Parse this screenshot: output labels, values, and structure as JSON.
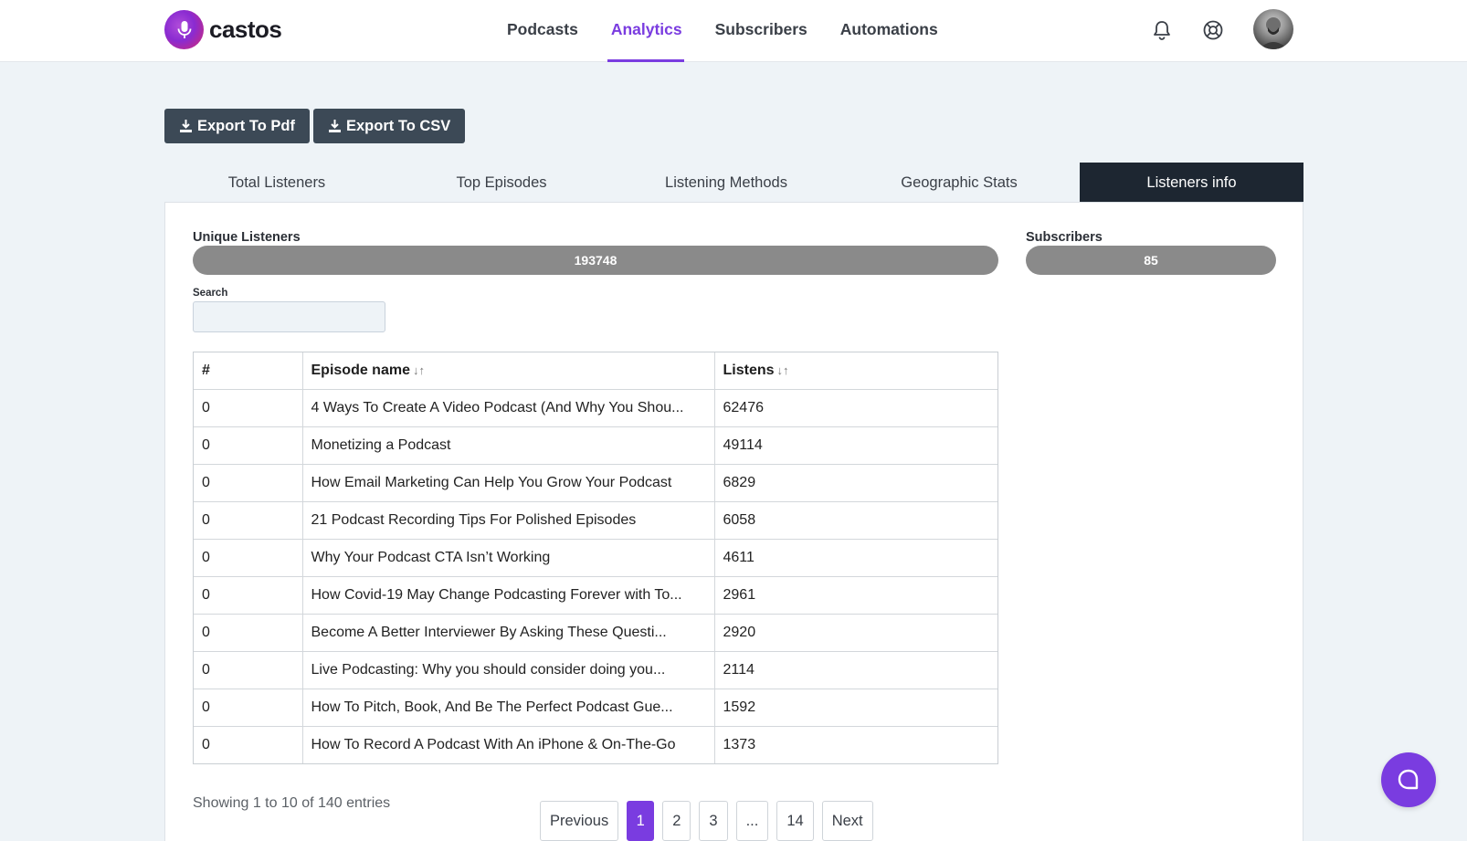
{
  "header": {
    "logo_text": "castos",
    "nav": [
      {
        "label": "Podcasts",
        "active": false
      },
      {
        "label": "Analytics",
        "active": true
      },
      {
        "label": "Subscribers",
        "active": false
      },
      {
        "label": "Automations",
        "active": false
      }
    ],
    "icons": [
      "bell-icon",
      "help-lifebuoy-icon",
      "avatar"
    ]
  },
  "toolbar": {
    "export_pdf_label": "Export To Pdf",
    "export_csv_label": "Export To CSV"
  },
  "tabs": [
    {
      "label": "Total Listeners",
      "active": false
    },
    {
      "label": "Top Episodes",
      "active": false
    },
    {
      "label": "Listening Methods",
      "active": false
    },
    {
      "label": "Geographic Stats",
      "active": false
    },
    {
      "label": "Listeners info",
      "active": true
    }
  ],
  "stats": {
    "unique_listeners_label": "Unique Listeners",
    "unique_listeners_value": "193748",
    "subscribers_label": "Subscribers",
    "subscribers_value": "85"
  },
  "search": {
    "label": "Search",
    "value": "",
    "placeholder": ""
  },
  "table": {
    "columns": [
      "#",
      "Episode name",
      "Listens"
    ],
    "sortable_columns": [
      "Episode name",
      "Listens"
    ],
    "rows": [
      {
        "num": "0",
        "episode": "4 Ways To Create A Video Podcast (And Why You Shou...",
        "listens": "62476"
      },
      {
        "num": "0",
        "episode": "Monetizing a Podcast",
        "listens": "49114"
      },
      {
        "num": "0",
        "episode": "How Email Marketing Can Help You Grow Your Podcast",
        "listens": "6829"
      },
      {
        "num": "0",
        "episode": "21 Podcast Recording Tips For Polished Episodes",
        "listens": "6058"
      },
      {
        "num": "0",
        "episode": "Why Your Podcast CTA Isn’t Working",
        "listens": "4611"
      },
      {
        "num": "0",
        "episode": "How Covid-19 May Change Podcasting Forever with To...",
        "listens": "2961"
      },
      {
        "num": "0",
        "episode": "Become A Better Interviewer By Asking These Questi...",
        "listens": "2920"
      },
      {
        "num": "0",
        "episode": "Live Podcasting: Why you should consider doing you...",
        "listens": "2114"
      },
      {
        "num": "0",
        "episode": "How To Pitch, Book, And Be The Perfect Podcast Gue...",
        "listens": "1592"
      },
      {
        "num": "0",
        "episode": "How To Record A Podcast With An iPhone & On-The-Go",
        "listens": "1373"
      }
    ]
  },
  "footer": {
    "showing_text": "Showing 1 to 10 of 140 entries",
    "pagination": {
      "previous_label": "Previous",
      "pages": [
        "1",
        "2",
        "3",
        "...",
        "14"
      ],
      "active_page": "1",
      "next_label": "Next"
    }
  },
  "colors": {
    "accent": "#7a3ce0",
    "dark_tab": "#1d2631",
    "export_button": "#3c4956",
    "stat_pill": "#8a8a8a"
  }
}
